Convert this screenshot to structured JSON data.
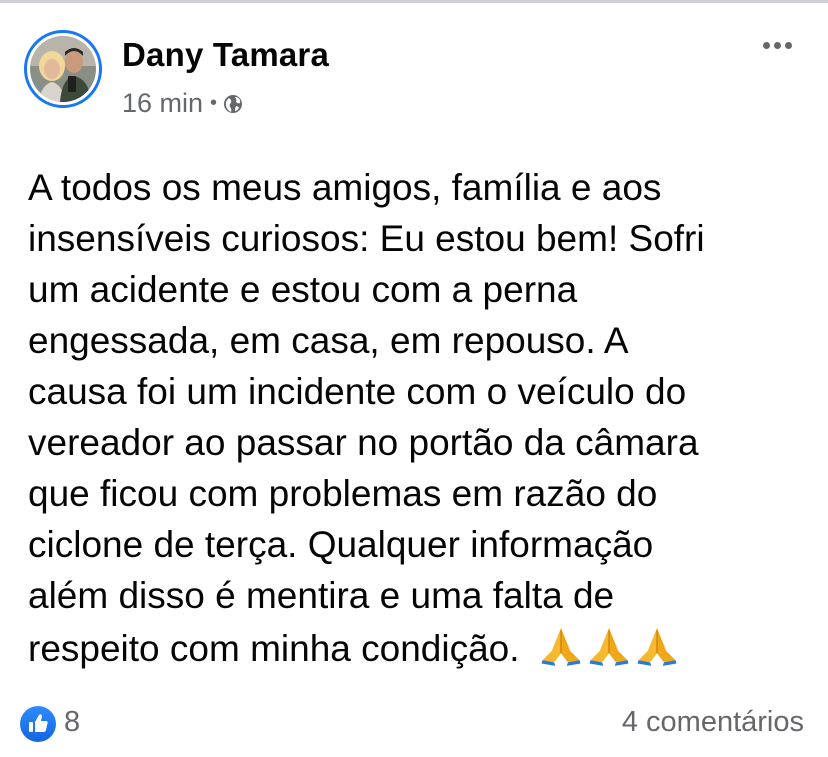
{
  "post": {
    "author": "Dany Tamara",
    "time": "16 min",
    "separator": "•",
    "privacy_icon": "globe-icon",
    "text_lines": [
      "A todos os meus amigos, família e aos",
      "insensíveis curiosos: Eu estou bem! Sofri",
      "um acidente e estou com a perna",
      "engessada, em casa, em repouso. A",
      "causa foi um incidente com o veículo do",
      "vereador ao passar no portão da câmara",
      "que ficou com problemas em razão do",
      "ciclone de terça. Qualquer informação",
      "além disso é mentira e uma falta de",
      "respeito com minha condição."
    ],
    "emoji_icons": [
      "folded-hands-icon",
      "folded-hands-icon",
      "folded-hands-icon"
    ]
  },
  "footer": {
    "reaction_icon": "like-icon",
    "reaction_count": "8",
    "comments": "4 comentários"
  },
  "colors": {
    "accent": "#1877f2",
    "secondary_text": "#65676b",
    "primary_text": "#050505"
  }
}
